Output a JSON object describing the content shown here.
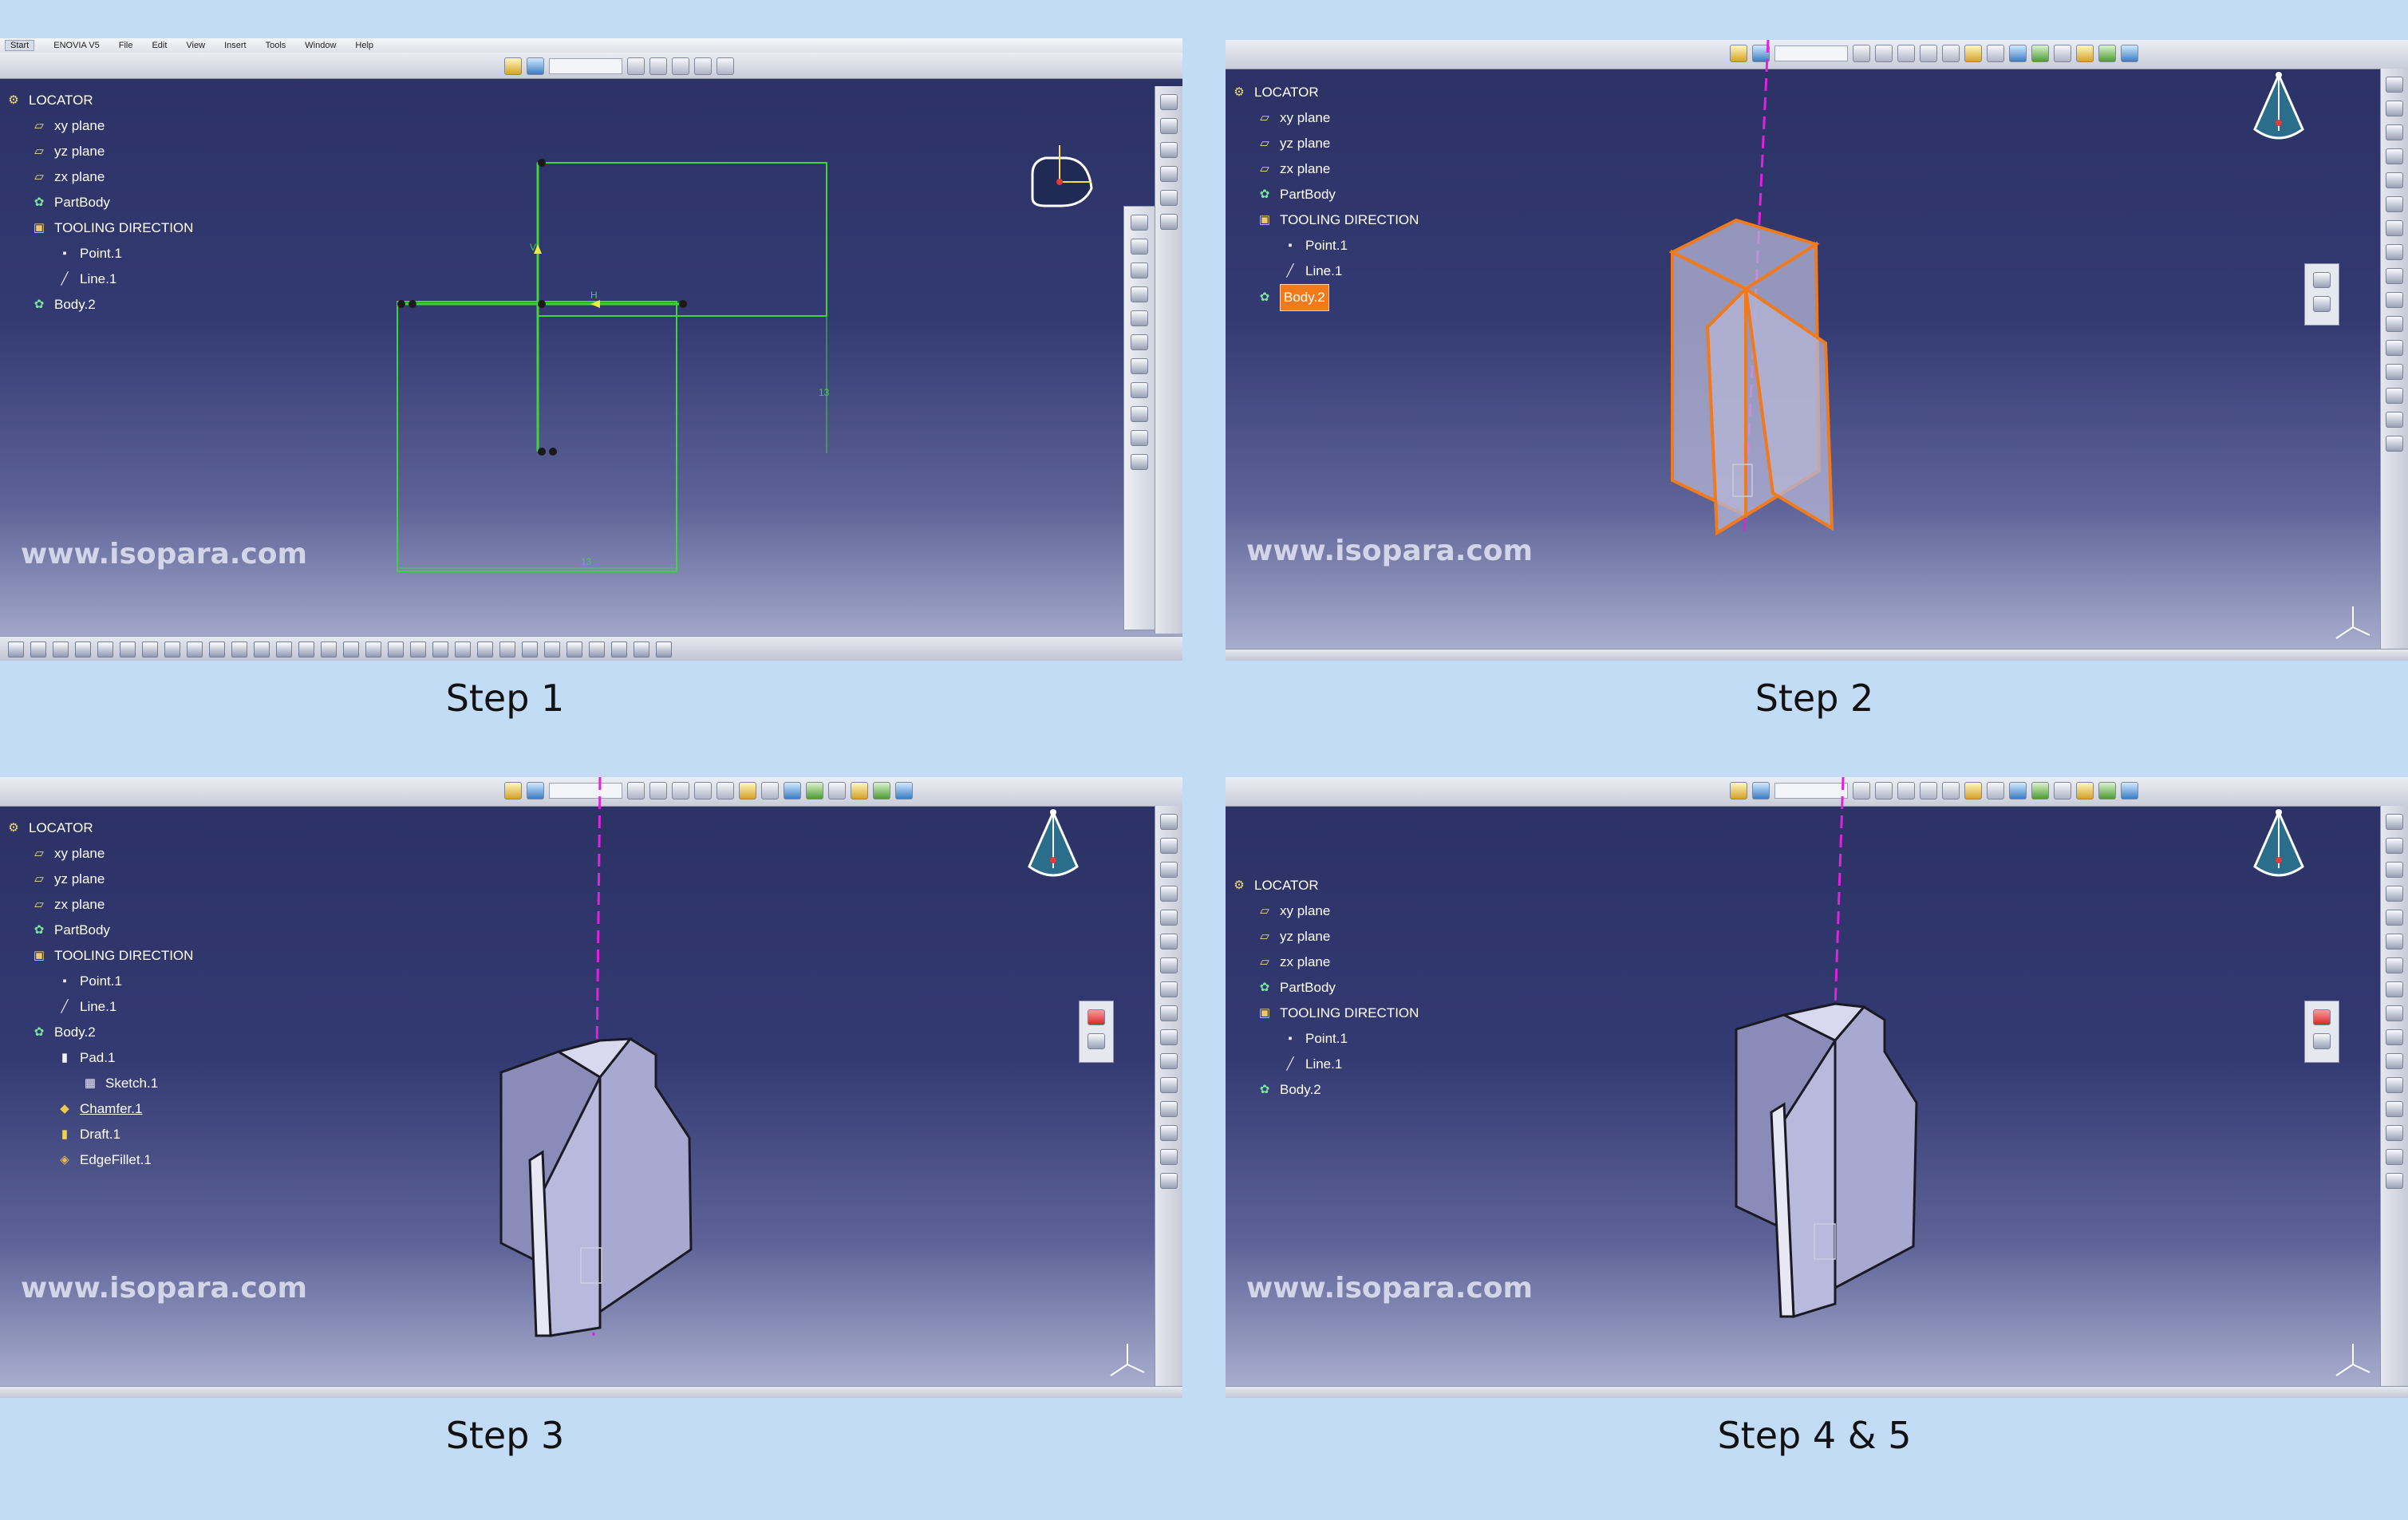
{
  "app_menu": {
    "items": [
      "Start",
      "ENOVIA V5",
      "File",
      "Edit",
      "View",
      "Insert",
      "Tools",
      "Window",
      "Help"
    ]
  },
  "watermark": "www.isopara.com",
  "panels": [
    {
      "caption": "Step 1",
      "tree": [
        "LOCATOR",
        "xy plane",
        "yz plane",
        "zx plane",
        "PartBody",
        "TOOLING DIRECTION",
        "Point.1",
        "Line.1",
        "Body.2"
      ],
      "sketch_labels": {
        "h": "H",
        "v": "V",
        "dim1": "13",
        "dim2": "13"
      }
    },
    {
      "caption": "Step 2",
      "tree": [
        "LOCATOR",
        "xy plane",
        "yz plane",
        "zx plane",
        "PartBody",
        "TOOLING DIRECTION",
        "Point.1",
        "Line.1",
        "Body.2"
      ]
    },
    {
      "caption": "Step 3",
      "tree": [
        "LOCATOR",
        "xy plane",
        "yz plane",
        "zx plane",
        "PartBody",
        "TOOLING DIRECTION",
        "Point.1",
        "Line.1",
        "Body.2",
        "Pad.1",
        "Sketch.1",
        "Chamfer.1",
        "Draft.1",
        "EdgeFillet.1"
      ]
    },
    {
      "caption": "Step 4 & 5",
      "tree": [
        "LOCATOR",
        "xy plane",
        "yz plane",
        "zx plane",
        "PartBody",
        "TOOLING DIRECTION",
        "Point.1",
        "Line.1",
        "Body.2"
      ]
    }
  ],
  "colors": {
    "background": "#c3dcf6",
    "sketch_green": "#3dd43d",
    "tooling_axis": "#e022e0",
    "selection_orange": "#f07a1c",
    "solid_face": "#a8a9d0"
  }
}
